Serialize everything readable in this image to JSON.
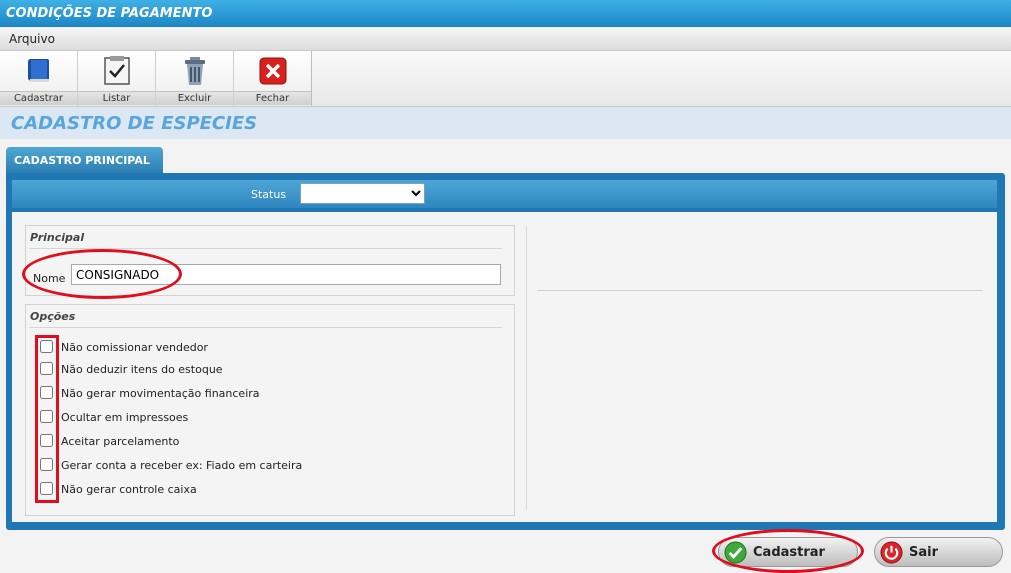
{
  "window": {
    "title": "CONDIÇÕES DE PAGAMENTO"
  },
  "menu": {
    "items": [
      {
        "label": "Arquivo"
      }
    ]
  },
  "toolbar": {
    "buttons": [
      {
        "label": "Cadastrar",
        "icon": "book-icon"
      },
      {
        "label": "Listar",
        "icon": "checklist-icon"
      },
      {
        "label": "Excluir",
        "icon": "trash-icon"
      },
      {
        "label": "Fechar",
        "icon": "close-icon"
      }
    ]
  },
  "page": {
    "title": "CADASTRO DE ESPECIES"
  },
  "tabs": [
    {
      "label": "CADASTRO PRINCIPAL",
      "active": true
    }
  ],
  "status": {
    "label": "Status",
    "value": ""
  },
  "principal": {
    "title": "Principal",
    "nome_label": "Nome",
    "nome_value": "CONSIGNADO"
  },
  "opcoes": {
    "title": "Opções",
    "items": [
      {
        "label": "Não comissionar vendedor",
        "checked": false
      },
      {
        "label": "Não deduzir itens do estoque",
        "checked": false
      },
      {
        "label": "Não gerar movimentação financeira",
        "checked": false
      },
      {
        "label": "Ocultar em impressoes",
        "checked": false
      },
      {
        "label": "Aceitar parcelamento",
        "checked": false
      },
      {
        "label": "Gerar conta a receber ex: Fiado em carteira",
        "checked": false
      },
      {
        "label": "Não gerar controle caixa",
        "checked": false
      }
    ]
  },
  "actions": {
    "cadastrar_label": "Cadastrar",
    "sair_label": "Sair"
  },
  "colors": {
    "accent": "#1f77b4",
    "title_bar": "#1b86c4",
    "heading": "#5aa6da",
    "annotation": "#e00d1c"
  }
}
